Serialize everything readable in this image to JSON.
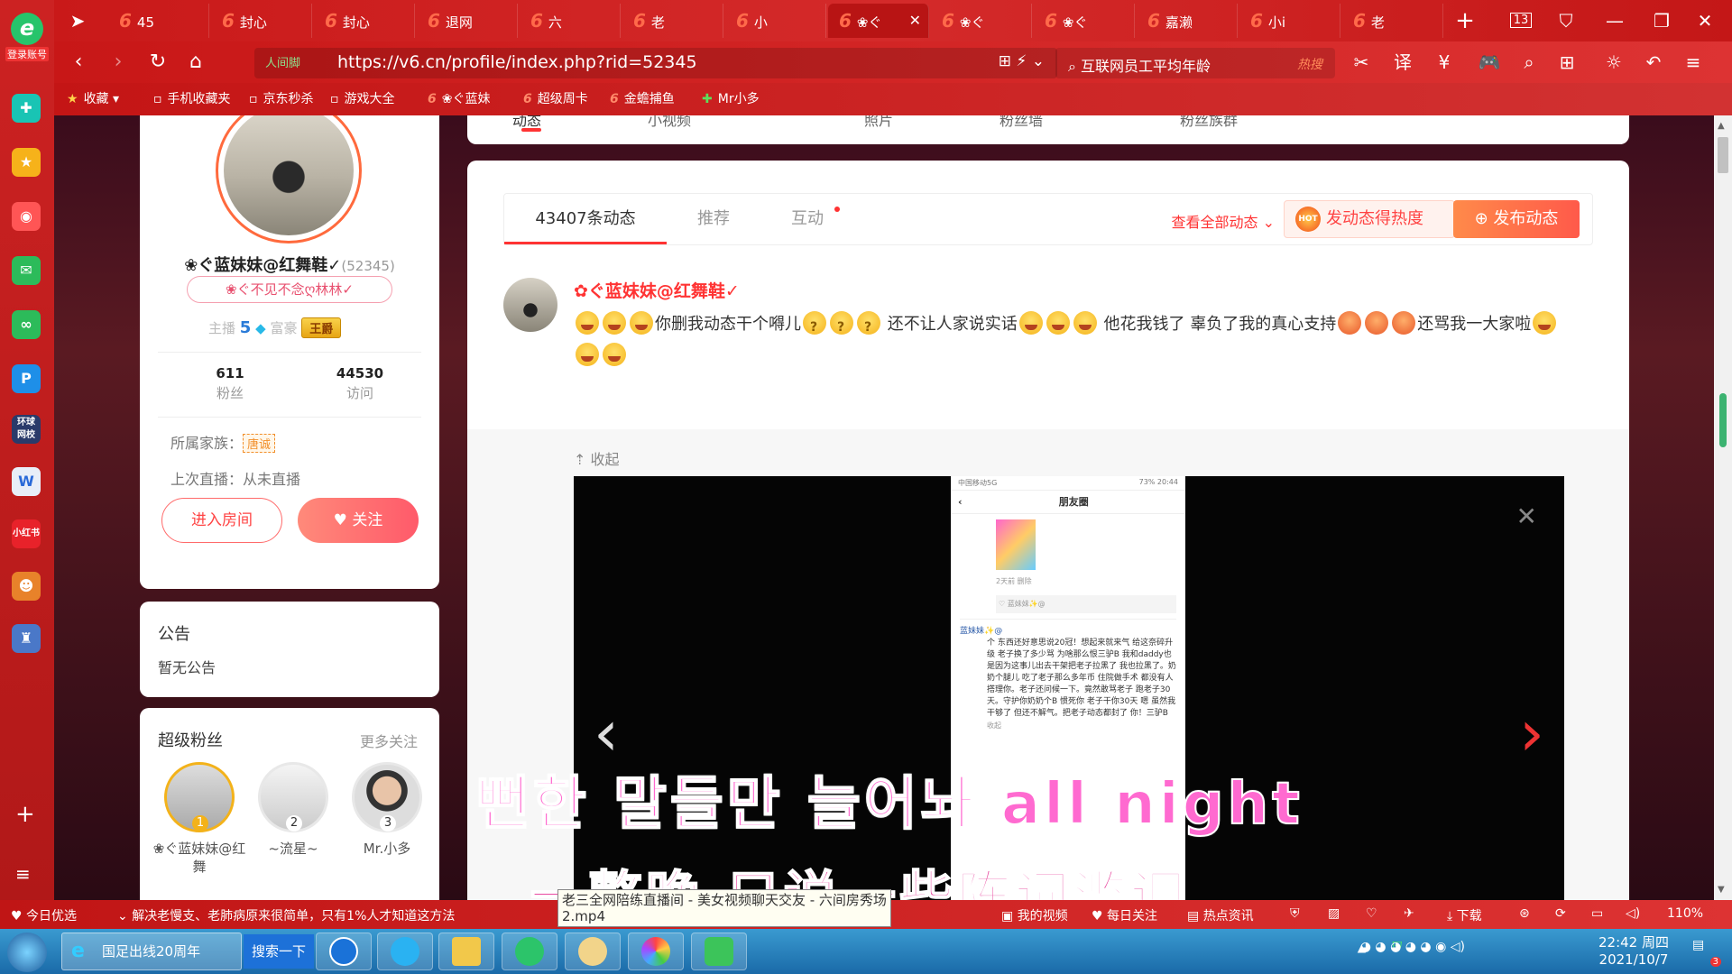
{
  "browser": {
    "logo_label": "登录账号",
    "tabs": [
      {
        "label": "45"
      },
      {
        "label": "封心"
      },
      {
        "label": "封心"
      },
      {
        "label": "退网"
      },
      {
        "label": "六"
      },
      {
        "label": "老"
      },
      {
        "label": "小"
      },
      {
        "label": "❀ぐ"
      },
      {
        "label": "❀ぐ"
      },
      {
        "label": "❀ぐ"
      },
      {
        "label": "嘉濑"
      },
      {
        "label": "小i"
      },
      {
        "label": "老"
      }
    ],
    "tab_count": "13",
    "address": {
      "security_label": "人间脚",
      "url": "https://v6.cn/profile/index.php?rid=52345"
    },
    "search": {
      "query": "互联网员工平均年龄",
      "hot_label": "热搜"
    },
    "bookmarks": [
      {
        "label": "收藏"
      },
      {
        "label": "手机收藏夹"
      },
      {
        "label": "京东秒杀"
      },
      {
        "label": "游戏大全"
      },
      {
        "label": "❀ぐ蓝妹"
      },
      {
        "label": "超级周卡"
      },
      {
        "label": "金蟾捕鱼"
      },
      {
        "label": "Mr小多"
      }
    ]
  },
  "profile": {
    "name": "❀ぐ蓝妹妹@红舞鞋✓",
    "rid": "(52345)",
    "signature": "❀ぐ不见不念ღ林林✓",
    "anchor_label": "主播",
    "anchor_level": "5",
    "rich_label": "富豪",
    "rich_badge": "王爵",
    "fans_count": "611",
    "fans_label": "粉丝",
    "visits_count": "44530",
    "visits_label": "访问",
    "family_label": "所属家族：",
    "family_value": "唐诚",
    "last_live": "上次直播：从未直播",
    "enter_room_button": "进入房间",
    "follow_button": "关注"
  },
  "top_strip": {
    "tabs": [
      "动态",
      "小视频",
      "照片",
      "粉丝墙",
      "粉丝族群"
    ]
  },
  "notice": {
    "title": "公告",
    "body": "暂无公告"
  },
  "super_fans": {
    "title": "超级粉丝",
    "more": "更多关注",
    "fans": [
      {
        "rank": "1",
        "name": "❀ぐ蓝妹妹@红舞"
      },
      {
        "rank": "2",
        "name": "~流星~"
      },
      {
        "rank": "3",
        "name": "Mr.小多"
      }
    ]
  },
  "feed": {
    "tabs": [
      {
        "label": "43407条动态"
      },
      {
        "label": "推荐"
      },
      {
        "label": "互动"
      }
    ],
    "view_all": "查看全部动态",
    "hot_button": "发动态得热度",
    "hot_icon_text": "HOT",
    "post_button": "发布动态",
    "post": {
      "author": "✿ぐ蓝妹妹@红舞鞋✓",
      "text_1": "你删我动态干个嘚儿",
      "text_2": "还不让人家说实话",
      "text_3": "他花我钱了 辜负了我的真心支持",
      "text_4": "还骂我一大家啦",
      "collapse": "收起"
    },
    "phone_screenshot": {
      "status_left": "中国移动5G",
      "status_right": "73% 20:44",
      "title": "朋友圈",
      "meta": "2天前  删除",
      "like_line": "♡ 蓝妹妹✨@",
      "comment_author": "蓝妹妹✨@",
      "comment_body": "个 东西还好意思说20冠！想起来就来气 给这奈碎升级 老子换了多少骂 为啥那么恨三驴B 我和daddy也是因为这事儿出去干架把老子拉黑了 我也拉黑了。奶奶个腿儿 吃了老子那么多年币 住院做手术 都没有人搭理你。老子还问候一下。竟然敢骂老子 跑老子30天。守护你奶奶个B 惯死你 老子干你30天 嗯 虽然我干够了 但还不解气。把老子动态都封了 你！三驴B",
      "collapse": "收起"
    }
  },
  "subtitles": {
    "korean": "뻔한 말들만 늘어놔 all night",
    "chinese": "一整晚 只说一些陈词滥调"
  },
  "tooltip": {
    "text": "老三全网陪练直播间 - 美女视频聊天交友 - 六间房秀场2.mp4"
  },
  "statusbar": {
    "left_item": "今日优选",
    "news": "解决老慢支、老肺病原来很简单，只有1%人才知道这方法",
    "my_video": "我的视频",
    "daily_follow": "每日关注",
    "hot_news": "热点资讯",
    "download": "下载",
    "zoom": "110%"
  },
  "taskbar": {
    "ie_title": "国足出线20周年",
    "search_button": "搜索一下",
    "time": "22:42 周四",
    "date": "2021/10/7",
    "notif_count": "3"
  }
}
